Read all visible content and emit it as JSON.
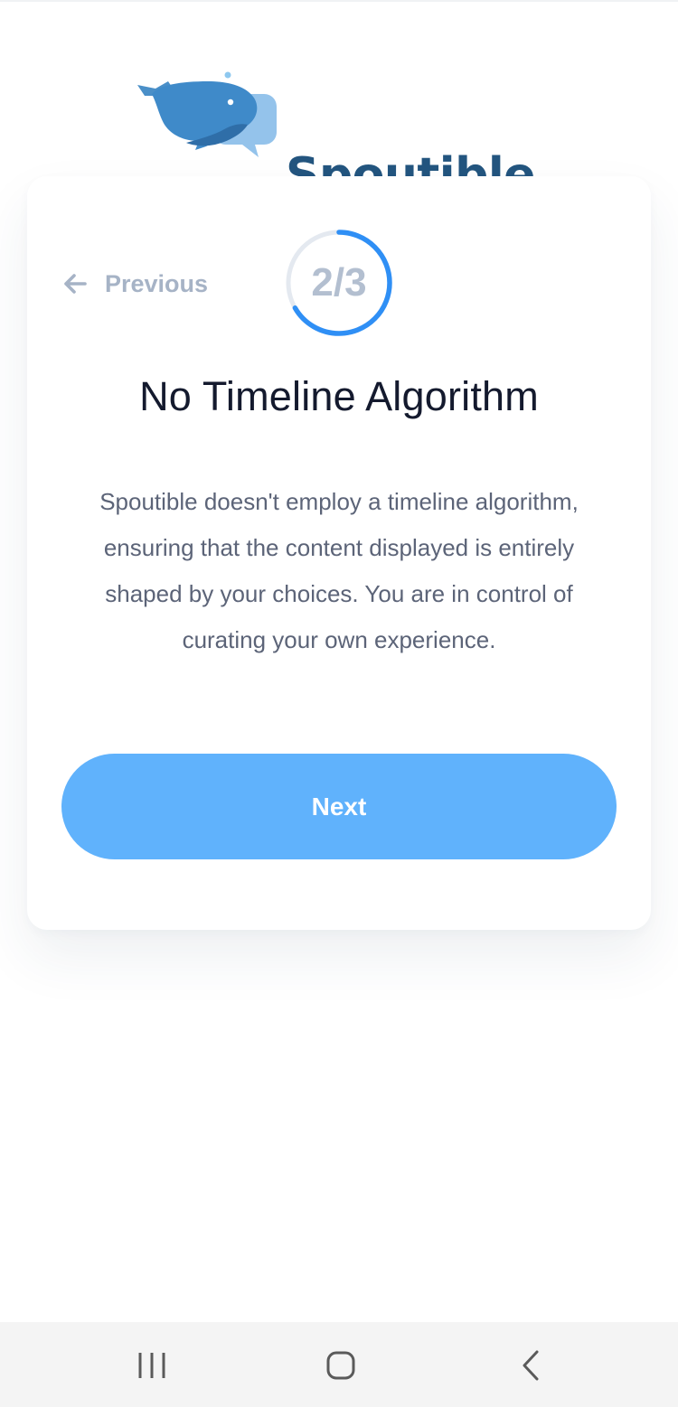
{
  "app": {
    "name": "Spoutible"
  },
  "onboarding": {
    "previous_label": "Previous",
    "step": {
      "current": 2,
      "total": 3,
      "label": "2/3"
    },
    "title": "No Timeline Algorithm",
    "description": "Spoutible doesn't employ a timeline algorithm, ensuring that the content displayed is entirely shaped by your choices. You are in control of curating your own experience.",
    "next_label": "Next"
  },
  "icons": {
    "back": "arrow-left-icon",
    "logo": "whale-logo-icon",
    "nav_recent": "recent-apps-icon",
    "nav_home": "home-icon",
    "nav_back": "chevron-left-icon"
  },
  "colors": {
    "brand_dark": "#23557f",
    "brand_light": "#60b2fc",
    "progress_ring": "#2f8ff5",
    "muted": "#a6b3c6",
    "title": "#141a2e",
    "body_text": "#5c6478"
  }
}
